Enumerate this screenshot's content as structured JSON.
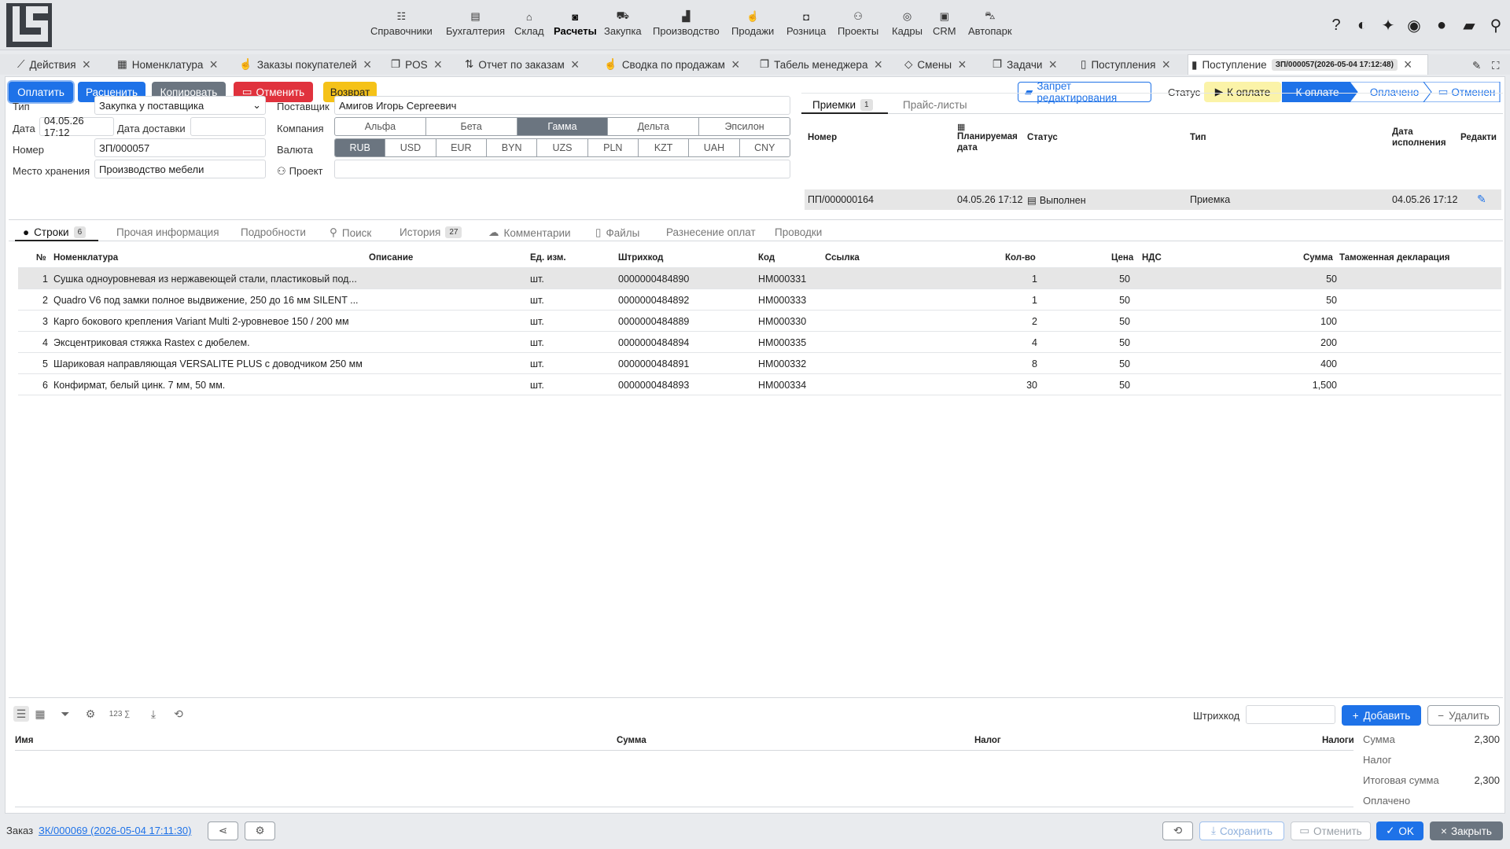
{
  "nav": [
    {
      "label": "Справочники",
      "icon": "list-check-icon"
    },
    {
      "label": "Бухгалтерия",
      "icon": "ledger-icon"
    },
    {
      "label": "Склад",
      "icon": "warehouse-icon"
    },
    {
      "label": "Расчеты",
      "icon": "cash-icon"
    },
    {
      "label": "Закупка",
      "icon": "cart-icon"
    },
    {
      "label": "Производство",
      "icon": "factory-icon"
    },
    {
      "label": "Продажи",
      "icon": "hand-coin-icon"
    },
    {
      "label": "Розница",
      "icon": "bag-icon"
    },
    {
      "label": "Проекты",
      "icon": "project-icon"
    },
    {
      "label": "Кадры",
      "icon": "fingerprint-icon"
    },
    {
      "label": "CRM",
      "icon": "id-card-icon"
    },
    {
      "label": "Автопарк",
      "icon": "bus-icon"
    }
  ],
  "tabs": [
    {
      "label": "Действия"
    },
    {
      "label": "Номенклатура"
    },
    {
      "label": "Заказы покупателей"
    },
    {
      "label": "POS"
    },
    {
      "label": "Отчет по заказам"
    },
    {
      "label": "Сводка по продажам"
    },
    {
      "label": "Табель менеджера"
    },
    {
      "label": "Смены"
    },
    {
      "label": "Задачи"
    },
    {
      "label": "Поступления"
    },
    {
      "label": "Поступление",
      "badge": "ЗП/000057(2026-05-04 17:12:48)"
    }
  ],
  "toolbar": {
    "pay": "Оплатить",
    "price": "Расценить",
    "copy": "Копировать",
    "cancel": "Отменить",
    "return": "Возврат",
    "lock": "Запрет редактирования",
    "status_label": "Статус",
    "status_value": "К оплате"
  },
  "steps": [
    "К оплате",
    "Оплачено",
    "Отменен"
  ],
  "form": {
    "type_label": "Тип",
    "type_value": "Закупка у поставщика",
    "date_label": "Дата",
    "date_value": "04.05.26 17:12",
    "delivery_label": "Дата доставки",
    "delivery_value": "",
    "number_label": "Номер",
    "number_value": "ЗП/000057",
    "storage_label": "Место хранения",
    "storage_value": "Производство мебели",
    "supplier_label": "Поставщик",
    "supplier_value": "Амигов Игорь Сергеевич",
    "company_label": "Компания",
    "companies": [
      "Альфа",
      "Бета",
      "Гамма",
      "Дельта",
      "Эпсилон"
    ],
    "company_selected": "Гамма",
    "currency_label": "Валюта",
    "currencies": [
      "RUB",
      "USD",
      "EUR",
      "BYN",
      "UZS",
      "PLN",
      "KZT",
      "UAH",
      "CNY"
    ],
    "currency_selected": "RUB",
    "project_label": "Проект",
    "project_value": ""
  },
  "receipts": {
    "tab1": "Приемки",
    "tab1_count": "1",
    "tab2": "Прайс-листы",
    "headers": {
      "number": "Номер",
      "planned": "Планируемая дата",
      "status": "Статус",
      "type": "Тип",
      "done": "Дата исполнения",
      "edit": "Редакти"
    },
    "row": {
      "number": "ПП/000000164",
      "planned": "04.05.26 17:12",
      "status": "Выполнен",
      "type": "Приемка",
      "done": "04.05.26 17:12"
    }
  },
  "subtabs": [
    {
      "label": "Строки",
      "count": "6"
    },
    {
      "label": "Прочая информация"
    },
    {
      "label": "Подробности"
    },
    {
      "label": "Поиск"
    },
    {
      "label": "История",
      "count": "27"
    },
    {
      "label": "Комментарии"
    },
    {
      "label": "Файлы"
    },
    {
      "label": "Разнесение оплат"
    },
    {
      "label": "Проводки"
    }
  ],
  "lines": {
    "headers": {
      "no": "№",
      "item": "Номенклатура",
      "desc": "Описание",
      "unit": "Ед. изм.",
      "barcode": "Штрихкод",
      "code": "Код",
      "link": "Ссылка",
      "qty": "Кол-во",
      "price": "Цена",
      "vat": "НДС",
      "sum": "Сумма",
      "customs": "Таможенная декларация"
    },
    "rows": [
      {
        "no": "1",
        "item": "Сушка одноуровневая из нержавеющей стали, пластиковый под...",
        "unit": "шт.",
        "barcode": "0000000484890",
        "code": "НМ000331",
        "qty": "1",
        "price": "50",
        "sum": "50"
      },
      {
        "no": "2",
        "item": "Quadro V6 под замки полное выдвижение, 250 до 16 мм SILENT ...",
        "unit": "шт.",
        "barcode": "0000000484892",
        "code": "НМ000333",
        "qty": "1",
        "price": "50",
        "sum": "50"
      },
      {
        "no": "3",
        "item": "Карго бокового крепления Variant Multi 2-уровневое 150 / 200 мм",
        "unit": "шт.",
        "barcode": "0000000484889",
        "code": "НМ000330",
        "qty": "2",
        "price": "50",
        "sum": "100"
      },
      {
        "no": "4",
        "item": "Эксцентриковая стяжка Rastex с дюбелем.",
        "unit": "шт.",
        "barcode": "0000000484894",
        "code": "НМ000335",
        "qty": "4",
        "price": "50",
        "sum": "200"
      },
      {
        "no": "5",
        "item": "Шариковая направляющая VERSALITE PLUS с доводчиком 250 мм",
        "unit": "шт.",
        "barcode": "0000000484891",
        "code": "НМ000332",
        "qty": "8",
        "price": "50",
        "sum": "400"
      },
      {
        "no": "6",
        "item": "Конфирмат, белый цинк. 7 мм, 50 мм.",
        "unit": "шт.",
        "barcode": "0000000484893",
        "code": "НМ000334",
        "qty": "30",
        "price": "50",
        "sum": "1,500"
      }
    ]
  },
  "bottom": {
    "barcode_label": "Штрихкод",
    "add": "Добавить",
    "delete": "Удалить",
    "tax_headers": {
      "name": "Имя",
      "sum": "Сумма",
      "tax": "Налог",
      "taxes": "Налоги"
    },
    "totals": [
      {
        "label": "Сумма",
        "value": "2,300"
      },
      {
        "label": "Налог",
        "value": ""
      },
      {
        "label": "Итоговая сумма",
        "value": "2,300"
      },
      {
        "label": "Оплачено",
        "value": ""
      }
    ]
  },
  "footer": {
    "order_label": "Заказ",
    "order_link": "ЗК/000069 (2026-05-04 17:11:30)",
    "save": "Сохранить",
    "cancel": "Отменить",
    "ok": "OK",
    "close": "Закрыть"
  },
  "colors": {
    "primary": "#1e72e8",
    "danger": "#e0323d",
    "warning": "#f5c218",
    "neutral": "#6b7580"
  }
}
